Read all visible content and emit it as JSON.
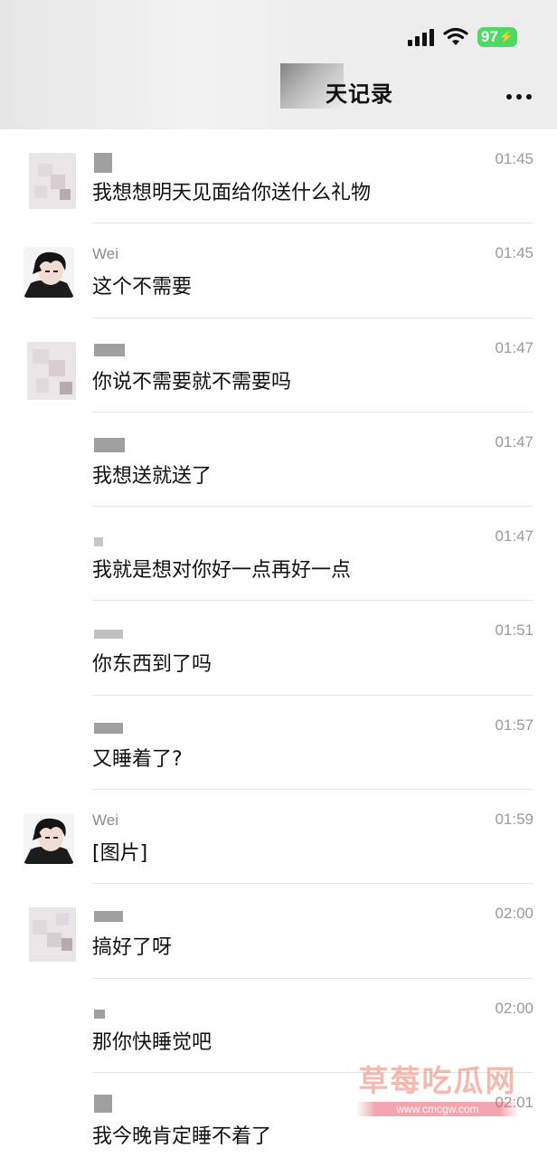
{
  "status_bar": {
    "battery": "97"
  },
  "header": {
    "title": "天记录"
  },
  "messages": [
    {
      "sender": "",
      "time": "01:45",
      "text": "我想想明天见面给你送什么礼物"
    },
    {
      "sender": "Wei",
      "time": "01:45",
      "text": "这个不需要"
    },
    {
      "sender": "",
      "time": "01:47",
      "text": "你说不需要就不需要吗"
    },
    {
      "sender": "",
      "time": "01:47",
      "text": "我想送就送了"
    },
    {
      "sender": "",
      "time": "01:47",
      "text": "我就是想对你好一点再好一点"
    },
    {
      "sender": "",
      "time": "01:51",
      "text": "你东西到了吗"
    },
    {
      "sender": "",
      "time": "01:57",
      "text": "又睡着了?"
    },
    {
      "sender": "Wei",
      "time": "01:59",
      "text": "[图片]"
    },
    {
      "sender": "",
      "time": "02:00",
      "text": "搞好了呀"
    },
    {
      "sender": "",
      "time": "02:00",
      "text": "那你快睡觉吧"
    },
    {
      "sender": "",
      "time": "02:01",
      "text": "我今晚肯定睡不着了"
    }
  ],
  "watermark": {
    "title": "草莓吃瓜网",
    "url": "www.cmcgw.com"
  },
  "colors": {
    "header_bg": "#ededed",
    "battery": "#4cd964",
    "watermark": "#e85a6e"
  }
}
